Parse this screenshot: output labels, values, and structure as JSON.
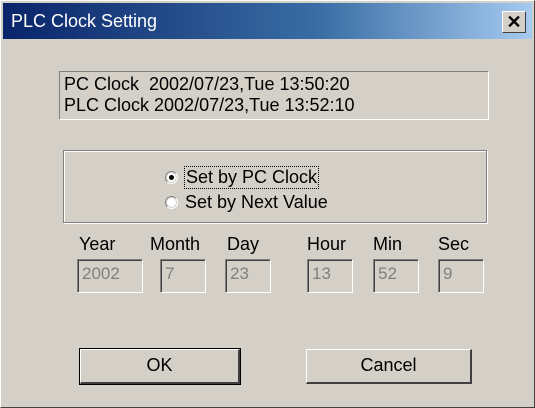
{
  "window": {
    "title": "PLC Clock Setting",
    "close_glyph": "✕"
  },
  "clock": {
    "pc_line": "PC Clock  2002/07/23,Tue 13:50:20",
    "plc_line": "PLC Clock 2002/07/23,Tue 13:52:10"
  },
  "options": {
    "set_by_pc": {
      "label": "Set by PC Clock",
      "selected": true
    },
    "set_by_next": {
      "label": "Set by Next Value",
      "selected": false
    }
  },
  "fields": {
    "year": {
      "label": "Year",
      "value": "2002"
    },
    "month": {
      "label": "Month",
      "value": "7"
    },
    "day": {
      "label": "Day",
      "value": "23"
    },
    "hour": {
      "label": "Hour",
      "value": "13"
    },
    "min": {
      "label": "Min",
      "value": "52"
    },
    "sec": {
      "label": "Sec",
      "value": "9"
    }
  },
  "buttons": {
    "ok": "OK",
    "cancel": "Cancel"
  },
  "colors": {
    "face": "#d4d0c8",
    "title_start": "#0a246a",
    "title_end": "#a6caf0",
    "disabled_text": "#808080"
  },
  "icons": {
    "close": "close-icon",
    "radio_selected": "radio-checked-icon",
    "radio_unselected": "radio-unchecked-icon"
  }
}
